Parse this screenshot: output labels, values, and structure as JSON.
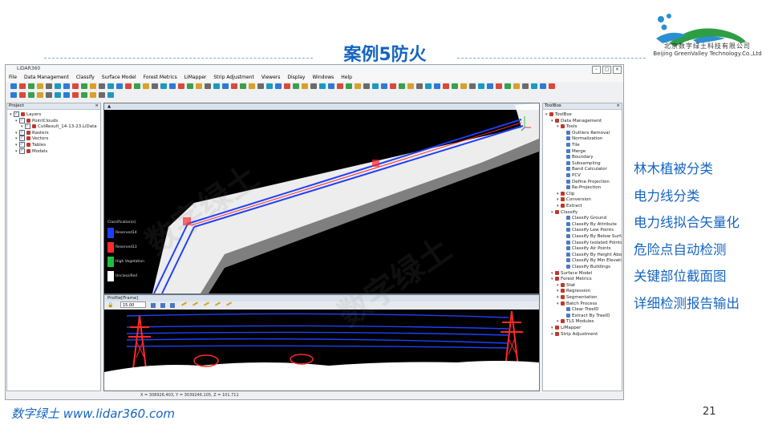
{
  "slide": {
    "title": "案例5防火",
    "logo_cn": "北京数字绿土科技有限公司",
    "logo_en": "Beijing GreenValley Technology.Co.,Ltd",
    "bullets": [
      "林木植被分类",
      "电力线分类",
      "电力线拟合矢量化",
      "危险点自动检测",
      "关键部位截面图",
      "详细检测报告输出"
    ],
    "footer_left": "数字绿土 www.lidar360.com",
    "page_number": "21",
    "watermark": "数字绿土"
  },
  "app": {
    "title": "LiDAR360",
    "window_buttons": [
      "–",
      "□",
      "×"
    ],
    "menu": [
      "File",
      "Data Management",
      "Classify",
      "Surface Model",
      "Forest Metrics",
      "LiMapper",
      "Strip Adjustment",
      "Viewers",
      "Display",
      "Windows",
      "Help"
    ],
    "project_panel": {
      "title": "Project",
      "tree": [
        {
          "label": "Layers",
          "level": 0
        },
        {
          "label": "PointClouds",
          "level": 1
        },
        {
          "label": "CutResult_14-13-23.LiData",
          "level": 2
        },
        {
          "label": "Rasters",
          "level": 1
        },
        {
          "label": "Vectors",
          "level": 1
        },
        {
          "label": "Tables",
          "level": 1
        },
        {
          "label": "Models",
          "level": 1
        }
      ]
    },
    "toolbox_panel": {
      "title": "ToolBox",
      "tree": [
        {
          "label": "ToolBox",
          "level": 0
        },
        {
          "label": "Data Management",
          "level": 1
        },
        {
          "label": "Tools",
          "level": 2
        },
        {
          "label": "Outliers Removal",
          "level": 3
        },
        {
          "label": "Normalization",
          "level": 3
        },
        {
          "label": "Tile",
          "level": 3
        },
        {
          "label": "Merge",
          "level": 3
        },
        {
          "label": "Boundary",
          "level": 3
        },
        {
          "label": "Subsampling",
          "level": 3
        },
        {
          "label": "Band Calculator",
          "level": 3
        },
        {
          "label": "PCV",
          "level": 3
        },
        {
          "label": "Define Projection",
          "level": 3
        },
        {
          "label": "Re-Projection",
          "level": 3
        },
        {
          "label": "Clip",
          "level": 2
        },
        {
          "label": "Conversion",
          "level": 2
        },
        {
          "label": "Extract",
          "level": 2
        },
        {
          "label": "Classify",
          "level": 1
        },
        {
          "label": "Classify Ground",
          "level": 3
        },
        {
          "label": "Classify By Attribute",
          "level": 3
        },
        {
          "label": "Classify Low Points",
          "level": 3
        },
        {
          "label": "Classify By Below Surface",
          "level": 3
        },
        {
          "label": "Classify Isolated Points",
          "level": 3
        },
        {
          "label": "Classify Air Points",
          "level": 3
        },
        {
          "label": "Classify By Height Above Gro",
          "level": 3
        },
        {
          "label": "Classify By Min Elevation",
          "level": 3
        },
        {
          "label": "Classify Buildings",
          "level": 3
        },
        {
          "label": "Surface Model",
          "level": 1
        },
        {
          "label": "Forest Metrics",
          "level": 1
        },
        {
          "label": "Stat",
          "level": 2
        },
        {
          "label": "Regression",
          "level": 2
        },
        {
          "label": "Segmentation",
          "level": 2
        },
        {
          "label": "Batch Process",
          "level": 2
        },
        {
          "label": "Clear TreeID",
          "level": 3
        },
        {
          "label": "Extract By TreeID",
          "level": 3
        },
        {
          "label": "TLS Modules",
          "level": 2
        },
        {
          "label": "LiMapper",
          "level": 1
        },
        {
          "label": "Strip Adjustment",
          "level": 1
        }
      ]
    },
    "main_view": {
      "legend_title": "Classification(s)",
      "legend": [
        {
          "label": "Reserved14",
          "color": "#1f3fff"
        },
        {
          "label": "Reserved13",
          "color": "#ff2a2a"
        },
        {
          "label": "High Vegetation",
          "color": "#20c040"
        },
        {
          "label": "Unclassified",
          "color": "#ffffff"
        }
      ]
    },
    "profile_view": {
      "title": "Profile[Frame]",
      "width_value": "15.00"
    },
    "status": {
      "coords": "X = 308926.403, Y = 3039246.105, Z = 101.711"
    }
  },
  "colors": {
    "accent": "#1565c0",
    "power_line": "#1f3fff",
    "tower": "#ff2a2a",
    "ground_cloud": "#ffffff"
  }
}
